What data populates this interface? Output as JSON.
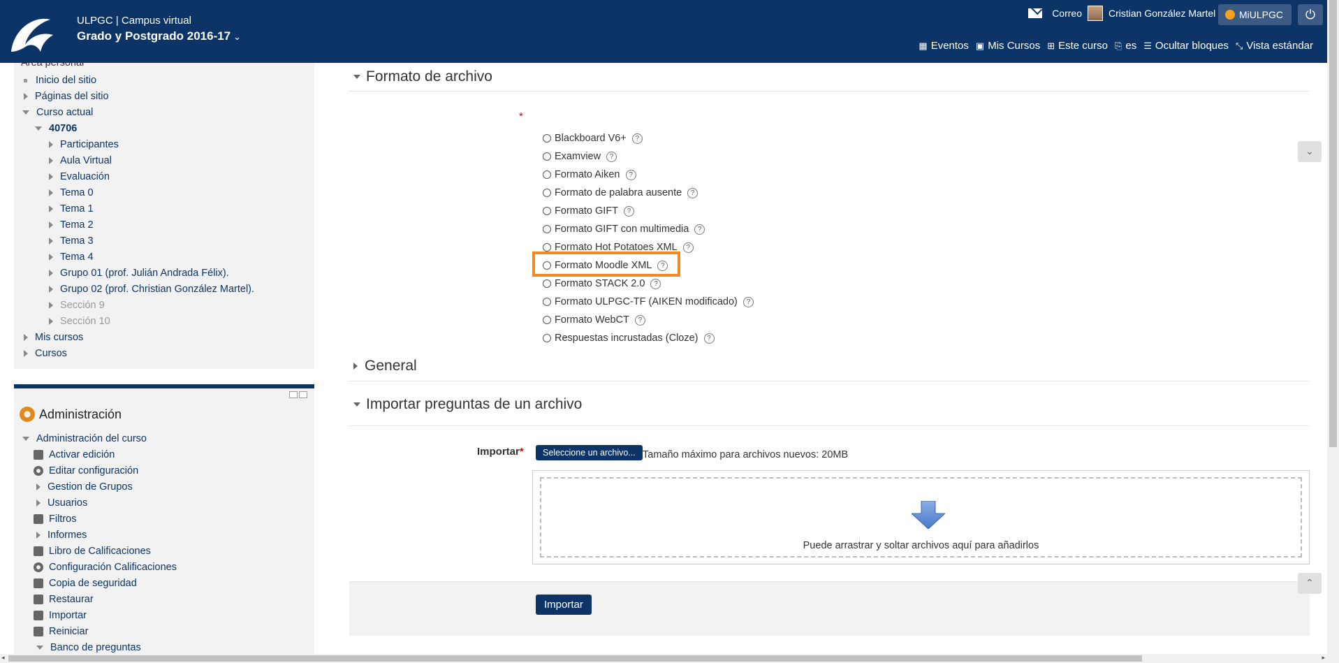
{
  "header": {
    "site_sub": "ULPGC | Campus virtual",
    "site_title": "Grado y Postgrado 2016-17",
    "mail_label": "Correo",
    "user_name": "Cristian González Martel",
    "miulpgc_label": "MiULPGC",
    "nav": [
      "Eventos",
      "Mis Cursos",
      "Este curso",
      "es",
      "Ocultar bloques",
      "Vista estándar"
    ]
  },
  "navigation": {
    "area_personal": "Área personal",
    "items": [
      "Inicio del sitio",
      "Páginas del sitio",
      "Curso actual",
      "40706",
      "Participantes",
      "Aula Virtual",
      "Evaluación",
      "Tema 0",
      "Tema 1",
      "Tema 2",
      "Tema 3",
      "Tema 4",
      "Grupo 01 (prof. Julián Andrada Félix).",
      "Grupo 02 (prof. Christian González Martel).",
      "Sección 9",
      "Sección 10",
      "Mis cursos",
      "Cursos"
    ]
  },
  "administration": {
    "title": "Administración",
    "items": [
      "Administración del curso",
      "Activar edición",
      "Editar configuración",
      "Gestion de Grupos",
      "Usuarios",
      "Filtros",
      "Informes",
      "Libro de Calificaciones",
      "Configuración Calificaciones",
      "Copia de seguridad",
      "Restaurar",
      "Importar",
      "Reiniciar",
      "Banco de preguntas"
    ]
  },
  "main": {
    "format_section": "Formato de archivo",
    "required_mark": "*",
    "formats": [
      "Blackboard V6+",
      "Examview",
      "Formato Aiken",
      "Formato de palabra ausente",
      "Formato GIFT",
      "Formato GIFT con multimedia",
      "Formato Hot Potatoes XML",
      "Formato Moodle XML",
      "Formato STACK 2.0",
      "Formato ULPGC-TF (AIKEN modificado)",
      "Formato WebCT",
      "Respuestas incrustadas (Cloze)"
    ],
    "help_glyph": "?",
    "general_section": "General",
    "import_section": "Importar preguntas de un archivo",
    "import_label": "Importar",
    "file_button": "Seleccione un archivo...",
    "max_size": "Tamaño máximo para archivos nuevos: 20MB",
    "drop_text": "Puede arrastrar y soltar archivos aquí para añadirlos",
    "submit_button": "Importar"
  },
  "colors": {
    "header_bg": "#0d3466",
    "highlight": "#f08a24",
    "block_bg": "#f2f2f2"
  }
}
